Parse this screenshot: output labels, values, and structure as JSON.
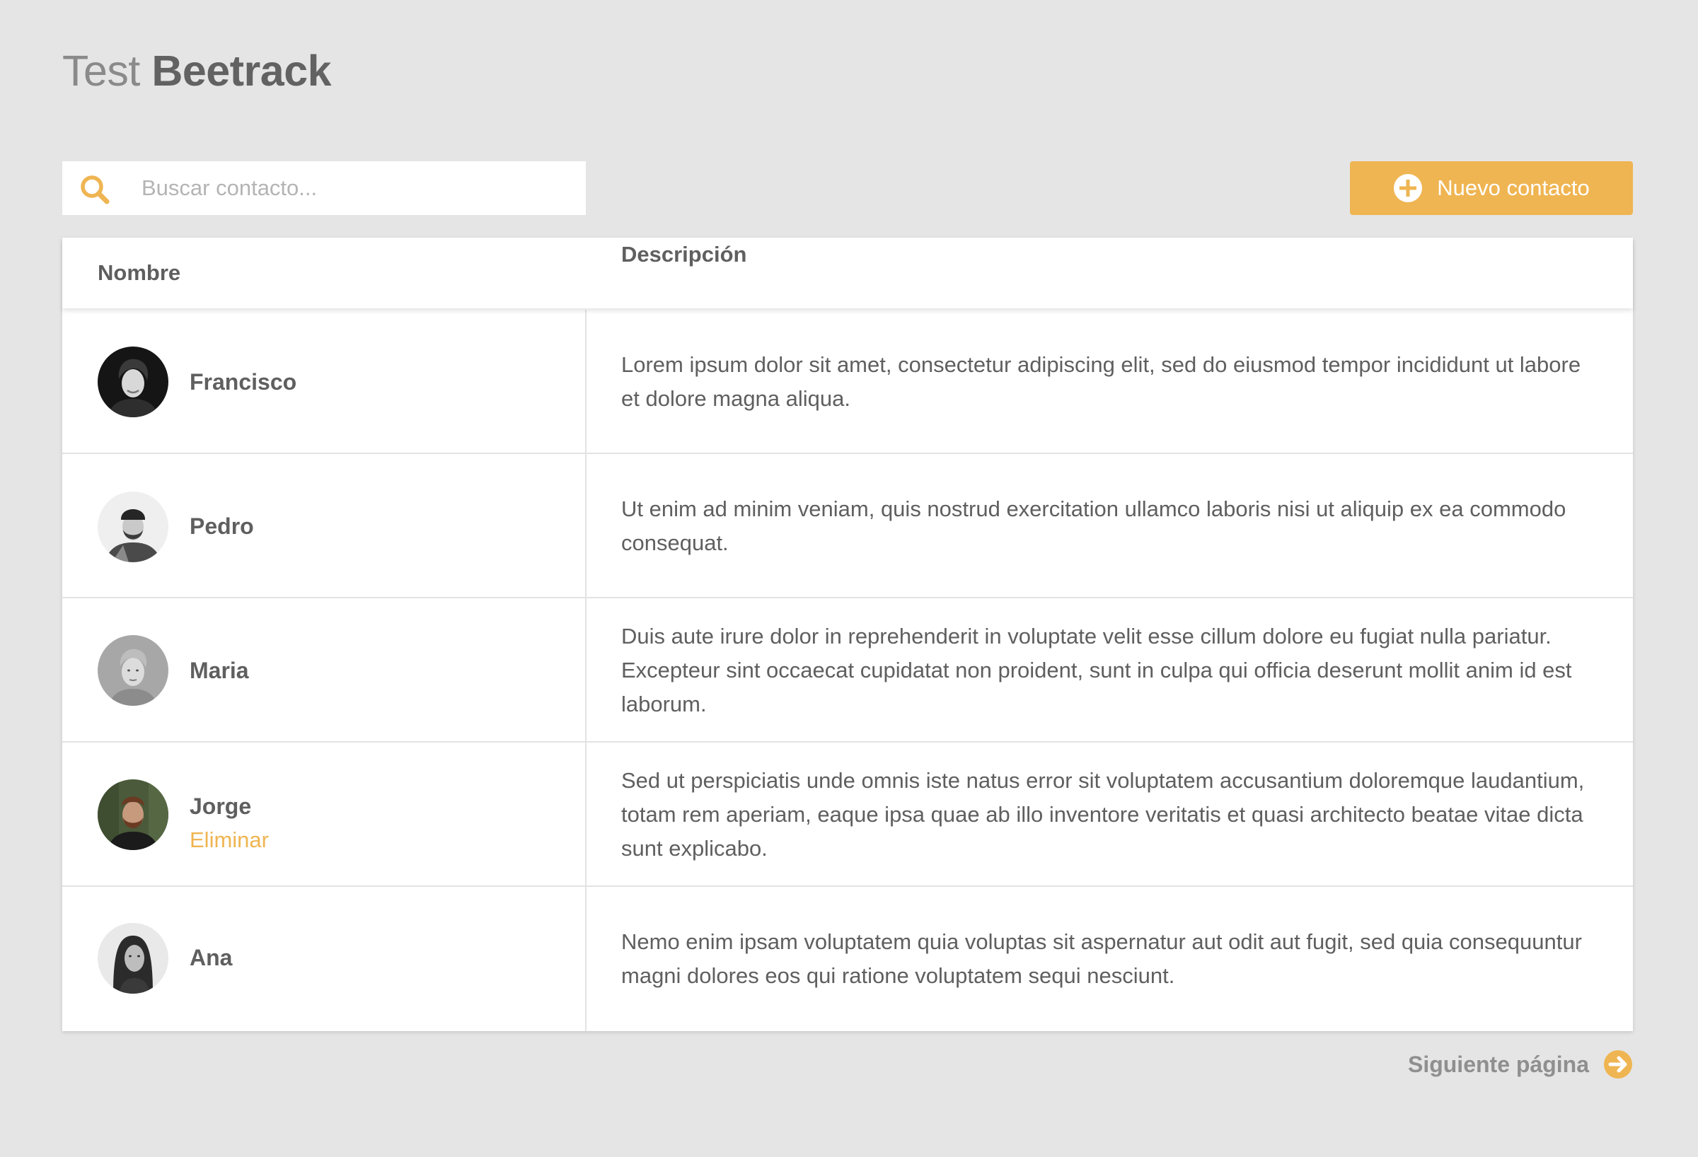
{
  "header": {
    "title_light": "Test",
    "title_bold": "Beetrack"
  },
  "search": {
    "placeholder": "Buscar contacto...",
    "value": "",
    "icon": "search-icon"
  },
  "new_contact_button": {
    "label": "Nuevo contacto",
    "icon": "plus-circle-icon"
  },
  "table": {
    "columns": [
      "Nombre",
      "Descripción"
    ],
    "rows": [
      {
        "name": "Francisco",
        "avatar": "avatar-photo",
        "description": "Lorem ipsum dolor sit amet, consectetur adipiscing elit, sed do eiusmod tempor incididunt ut labore et dolore magna aliqua."
      },
      {
        "name": "Pedro",
        "avatar": "avatar-photo",
        "description": "Ut enim ad minim veniam, quis nostrud exercitation ullamco laboris nisi ut aliquip ex ea commodo consequat."
      },
      {
        "name": "Maria",
        "avatar": "avatar-photo",
        "description": "Duis aute irure dolor in reprehenderit in voluptate velit esse cillum dolore eu fugiat nulla pariatur. Excepteur sint occaecat cupidatat non proident, sunt in culpa qui officia deserunt mollit anim id est laborum."
      },
      {
        "name": "Jorge",
        "avatar": "avatar-photo",
        "description": "Sed ut perspiciatis unde omnis iste natus error sit voluptatem accusantium doloremque laudantium, totam rem aperiam, eaque ipsa quae ab illo inventore veritatis et quasi architecto beatae vitae dicta sunt explicabo.",
        "action": "Eliminar"
      },
      {
        "name": "Ana",
        "avatar": "avatar-photo",
        "description": "Nemo enim ipsam voluptatem quia voluptas sit aspernatur aut odit aut fugit, sed quia consequuntur magni dolores eos qui ratione voluptatem sequi nesciunt."
      }
    ]
  },
  "pagination": {
    "next_label": "Siguiente página",
    "icon": "arrow-right-circle-icon"
  },
  "colors": {
    "accent": "#efb552",
    "background": "#e5e5e5",
    "text": "#606060"
  }
}
